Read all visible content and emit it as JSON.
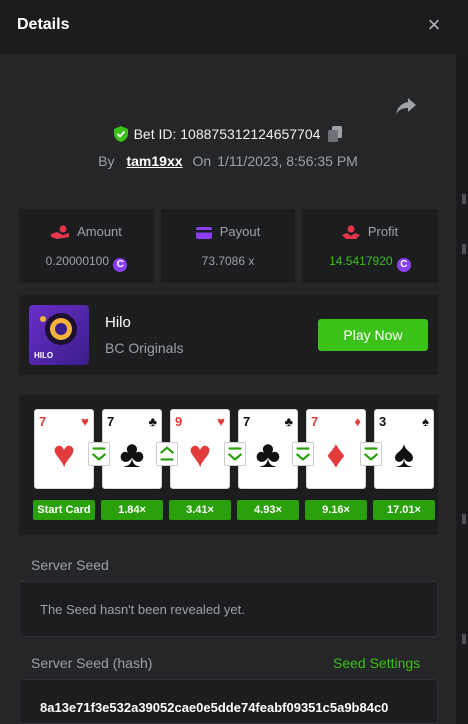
{
  "header": {
    "title": "Details",
    "close": "×"
  },
  "bet": {
    "id_label": "Bet ID: 108875312124657704",
    "by": "By",
    "user": "tam19xx",
    "on": "On",
    "datetime": "1/11/2023, 8:56:35 PM"
  },
  "stats": [
    {
      "label": "Amount",
      "value": "0.20000100",
      "icon": "coins-hand-icon"
    },
    {
      "label": "Payout",
      "value": "73.7086 x",
      "icon": "card-icon"
    },
    {
      "label": "Profit",
      "value": "14.5417920",
      "icon": "profit-hand-icon"
    }
  ],
  "game": {
    "name": "Hilo",
    "provider": "BC Originals",
    "thumb_label": "HILO",
    "play_label": "Play Now"
  },
  "cards": [
    {
      "rank": "7",
      "suit": "♥",
      "color": "red"
    },
    {
      "rank": "7",
      "suit": "♣",
      "color": "black"
    },
    {
      "rank": "9",
      "suit": "♥",
      "color": "red"
    },
    {
      "rank": "7",
      "suit": "♣",
      "color": "black"
    },
    {
      "rank": "7",
      "suit": "♦",
      "color": "red"
    },
    {
      "rank": "3",
      "suit": "♠",
      "color": "black"
    }
  ],
  "arrows": [
    "down",
    "up",
    "down",
    "down",
    "down"
  ],
  "multipliers": [
    "Start Card",
    "1.84×",
    "3.41×",
    "4.93×",
    "9.16×",
    "17.01×"
  ],
  "server_seed": {
    "label": "Server Seed",
    "message": "The Seed hasn't been revealed yet."
  },
  "server_seed_hash": {
    "label": "Server Seed (hash)",
    "settings_label": "Seed Settings",
    "hash": "8a13e71f3e532a39052cae0e5dde74feabf09351c5a9b84c0"
  },
  "colors": {
    "accent": "#3bc117",
    "coin": "#8a3ff0",
    "amount_icon": "#e8364d",
    "payout_icon": "#8a3ff0",
    "profit_icon": "#e8364d"
  }
}
